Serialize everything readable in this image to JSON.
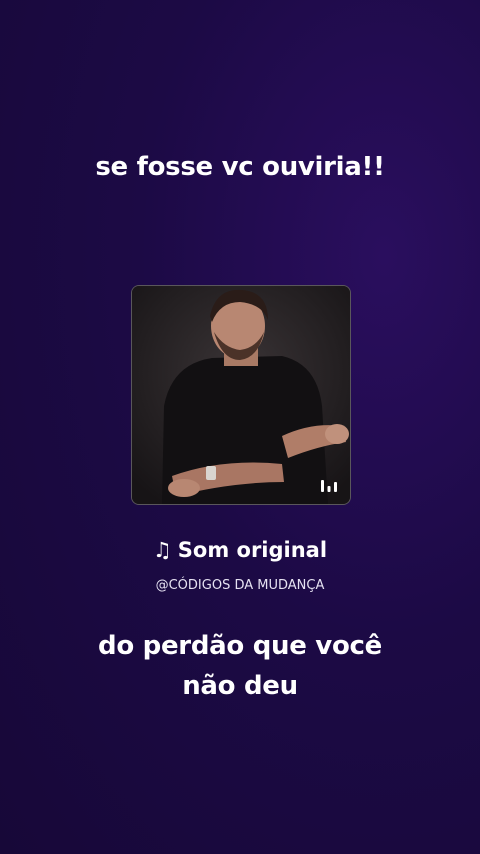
{
  "captions": {
    "top": "se fosse vc ouviria!!",
    "bottom_line1": "do perdão que você",
    "bottom_line2": "não deu"
  },
  "audio": {
    "note_icon": "♫",
    "title": "Som original",
    "handle": "@CÓDIGOS DA MUDANÇA",
    "cover_icon": "audio-wave-icon"
  },
  "colors": {
    "background": "#1c0a45",
    "text": "#ffffff"
  }
}
